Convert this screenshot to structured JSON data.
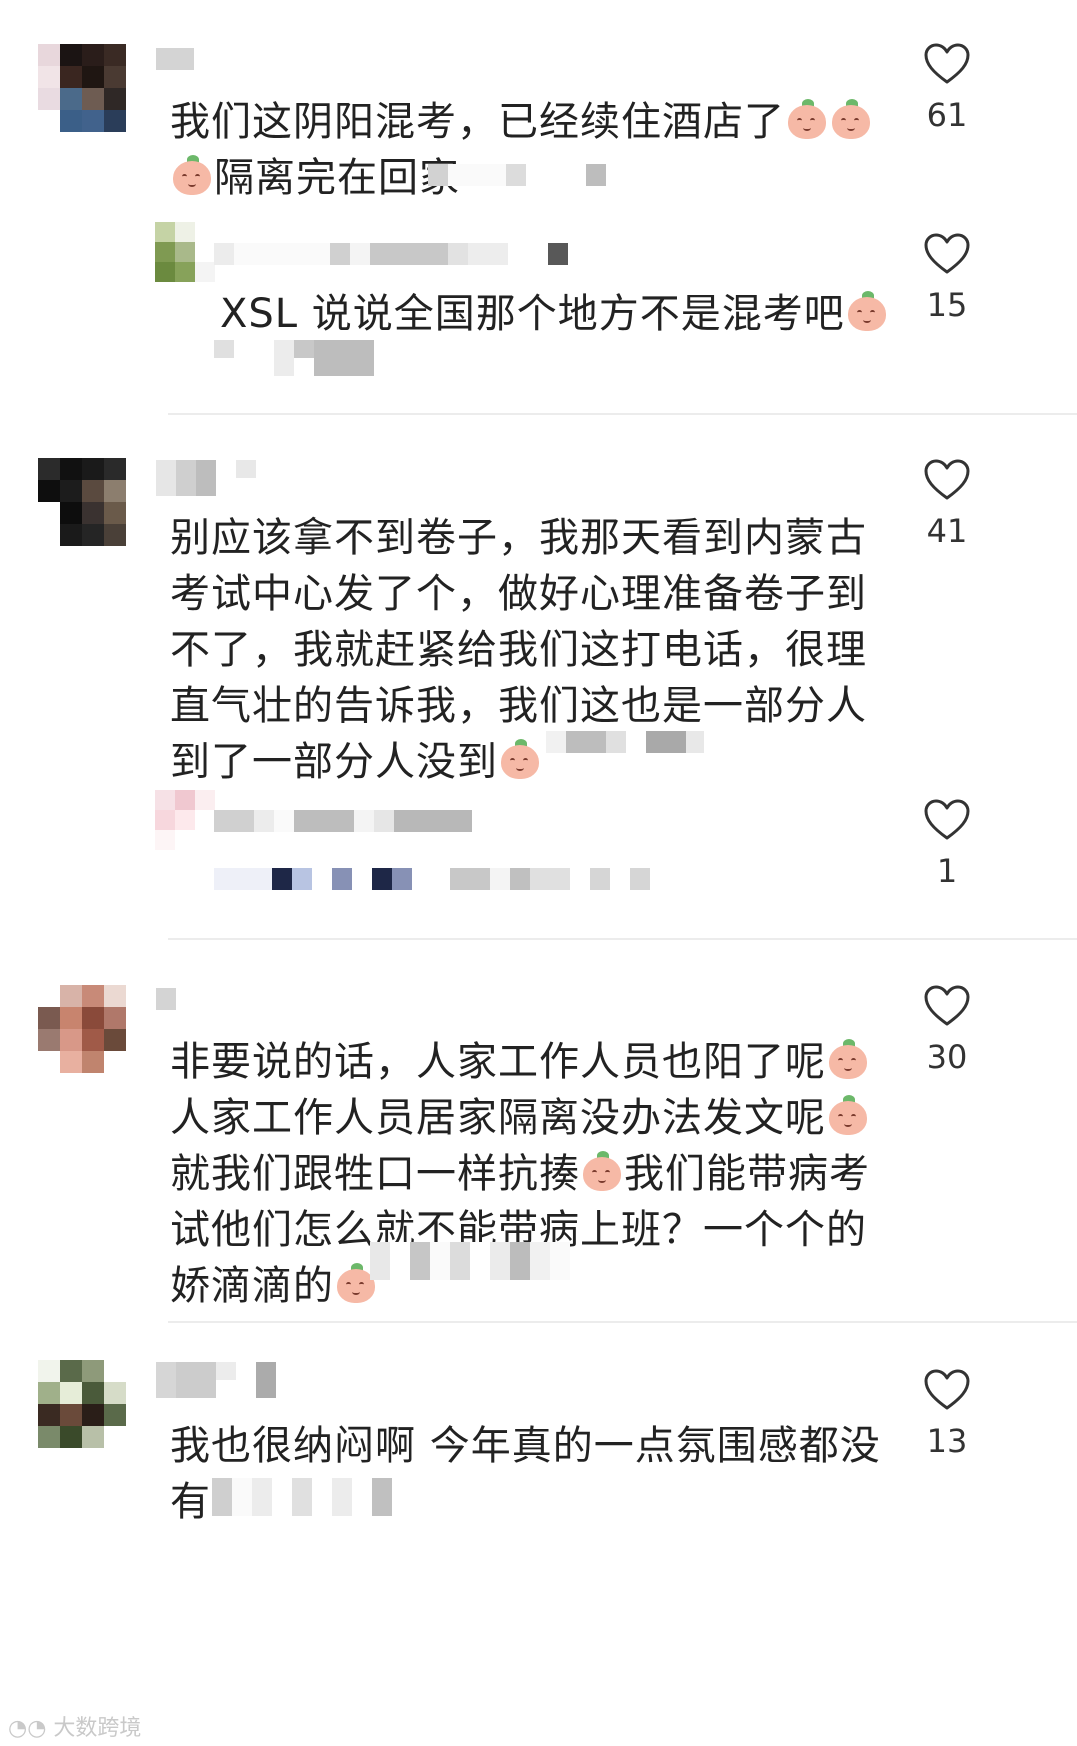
{
  "comments": [
    {
      "text_lines": [
        "我们这阴阳混考，已经续住酒店了",
        "隔离完在回家"
      ],
      "likes": "61",
      "reply": {
        "text": "XSL 说说全国那个地方不是混考吧",
        "likes": "15"
      }
    },
    {
      "text_lines": [
        "别应该拿不到卷子，我那天看到内蒙古",
        "考试中心发了个，做好心理准备卷子到",
        "不了，我就赶紧给我们这打电话，很理",
        "直气壮的告诉我，我们这也是一部分人",
        "到了一部分人没到"
      ],
      "likes": "41",
      "reply": {
        "likes": "1"
      }
    },
    {
      "text_lines": [
        "非要说的话，人家工作人员也阳了呢",
        "人家工作人员居家隔离没办法发文呢",
        "就我们跟牲口一样抗揍",
        "我们能带病考",
        "试他们怎么就不能带病上班？一个个的",
        "娇滴滴的"
      ],
      "likes": "30"
    },
    {
      "text_lines": [
        "我也很纳闷啊 今年真的一点氛围感都没",
        "有"
      ],
      "likes": "13"
    }
  ],
  "icons": {
    "like": "heart-outline-icon",
    "emoji": "peach-face-emoji-icon"
  },
  "watermark": "大数跨境",
  "colors": {
    "text": "#222222",
    "divider": "#ececec",
    "icon": "#333333"
  }
}
